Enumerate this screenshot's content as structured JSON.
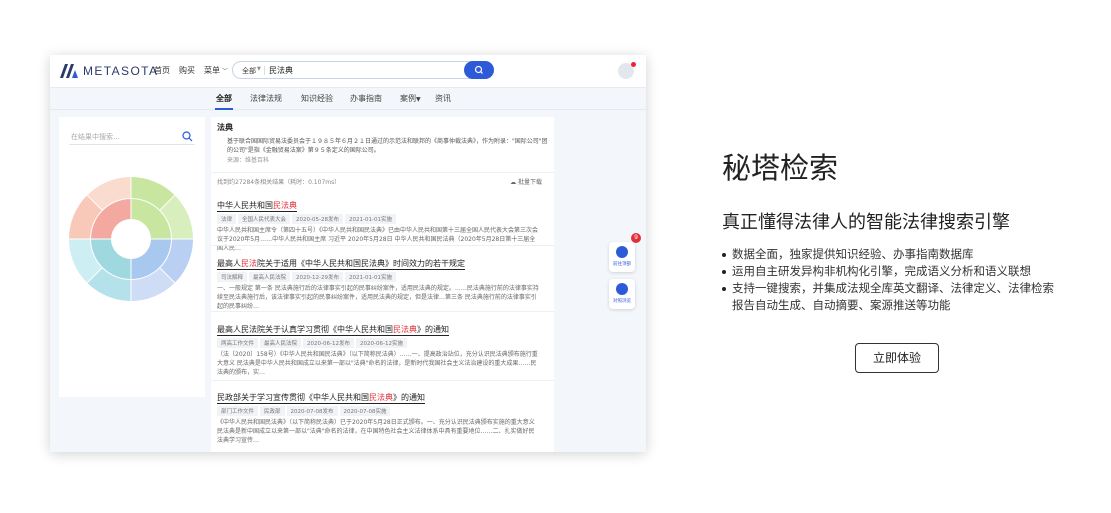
{
  "app": {
    "logo_text": "METASOTA",
    "nav": [
      "首页",
      "购买",
      "菜单"
    ],
    "search_scope": "全部",
    "search_query": "民法典"
  },
  "tabs": [
    "全部",
    "法律法规",
    "知识经验",
    "办事指南",
    "案例",
    "资讯"
  ],
  "filter_placeholder": "在结果中搜索...",
  "dictionary": {
    "title": "法典",
    "desc": "基于联合国国际贸易法委员会于１９８５年６月２１日通过的示范法和联邦的《商事仲裁法典》，作为附录：\"国际公司\"团的公司\"是指《金融贸易法案》第９５条定义的国际公司。",
    "source": "来源：维基百科"
  },
  "result_count": "找到约27284条相关结果（耗时：0.107ms）",
  "download_label": "批量下载",
  "results": [
    {
      "title_pre": "中华人民共和国",
      "title_hl": "民法典",
      "title_post": "",
      "tags": [
        "法律",
        "全国人民代表大会",
        "2020-05-28发布",
        "2021-01-01实施"
      ],
      "text": "中华人民共和国主席令（第四十五号）《中华人民共和国民法典》已由中华人民共和国第十三届全国人民代表大会第三次会议于2020年5月……中华人民共和国主席 习近平 2020年5月28日 中华人民共和国民法典（2020年5月28日第十三届全国人民…"
    },
    {
      "title_pre": "最高人",
      "title_hl": "民法",
      "title_post": "院关于适用《中华人民共和国民法典》时间效力的若干规定",
      "tags": [
        "司法解释",
        "最高人民法院",
        "2020-12-29发布",
        "2021-01-01实施"
      ],
      "text": "一、一般规定 第一条 民法典施行后的法律事实引起的民事纠纷案件，适用民法典的规定。……民法典施行前的法律事实持续至民法典施行后，该法律事实引起的民事纠纷案件，适用民法典的规定，但是法律…第三条 民法典施行前的法律事实引起的民事纠纷…"
    },
    {
      "title_pre": "最高人民法院关于认真学习贯彻《中华人民共和国",
      "title_hl": "民法典",
      "title_post": "》的通知",
      "tags": [
        "两高工作文件",
        "最高人民法院",
        "2020-06-12发布",
        "2020-06-12实施"
      ],
      "text": "（法〔2020〕158号）《中华人民共和国民法典》（以下简称民法典）……一、提高政治站位，充分认识民法典颁布施行重大意义 民法典是中华人民共和国成立以来第一部以\"法典\"命名的法律，是新时代我国社会主义法治建设的重大成果……民法典的颁布，实…"
    },
    {
      "title_pre": "民政部关于学习宣传贯彻《中华人民共和国",
      "title_hl": "民法典",
      "title_post": "》的通知",
      "tags": [
        "部门工作文件",
        "民政部",
        "2020-07-08发布",
        "2020-07-08实施"
      ],
      "text": "《中华人民共和国民法典》（以下简称民法典）已于2020年5月28日正式颁布。一、充分认识民法典颁布实施的重大意义 民法典是新中国成立以来第一部以\"法典\"命名的法律，在中国特色社会主义法律体系中具有重要地位……二、扎实做好民法典学习宣传…"
    }
  ],
  "float_buttons": [
    "前往顶部",
    "对照浏览"
  ],
  "badge_count": "9",
  "hero": {
    "title": "秘塔检索",
    "subtitle": "真正懂得法律人的智能法律搜索引擎",
    "features": [
      "数据全面，独家提供知识经验、办事指南数据库",
      "运用自主研发异构非机构化引擎，完成语义分析和语义联想",
      "支持一键搜索，并集成法规全库英文翻译、法律定义、法律检索",
      "报告自动生成、自动摘要、案源推送等功能"
    ],
    "cta": "立即体验"
  },
  "colors": {
    "brand_blue": "#2d5bd7",
    "highlight_red": "#e0303a",
    "sunburst": [
      "#f4a9a0",
      "#c8e6a0",
      "#a8c8f0",
      "#a0d8e0",
      "#f8c8b8",
      "#dde3ec"
    ]
  }
}
